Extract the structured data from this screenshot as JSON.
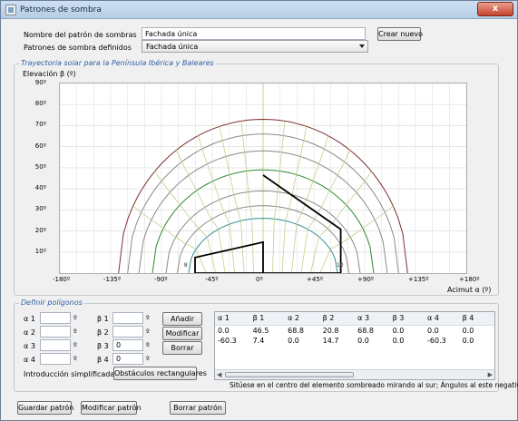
{
  "window": {
    "title": "Patrones de sombra",
    "close_label": "x"
  },
  "form": {
    "name_label": "Nombre del patrón de sombras",
    "name_value": "Fachada única",
    "create_button": "Crear nuevo",
    "defined_label": "Patrones de sombra definidos",
    "defined_value": "Fachada única"
  },
  "chart_group": {
    "title": "Trayectoria solar para la Península Ibérica y Baleares"
  },
  "chart_data": {
    "type": "line",
    "ylabel": "Elevación β (º)",
    "xlabel": "Acimut α (º)",
    "y_ticks": [
      "90º",
      "80º",
      "70º",
      "60º",
      "50º",
      "40º",
      "30º",
      "20º",
      "10º"
    ],
    "x_ticks": [
      "-180º",
      "-135º",
      "-90º",
      "-45º",
      "0º",
      "+45º",
      "+90º",
      "+135º",
      "+180º"
    ],
    "xlim": [
      -180,
      180
    ],
    "ylim": [
      0,
      90
    ],
    "sun_paths": [
      {
        "max_elevation": 73,
        "half_width": 128,
        "color": "#7f3030"
      },
      {
        "max_elevation": 66,
        "half_width": 120,
        "color": "#8a8a8a"
      },
      {
        "max_elevation": 58,
        "half_width": 110,
        "color": "#8a8a8a"
      },
      {
        "max_elevation": 49,
        "half_width": 98,
        "color": "#2f8a2f"
      },
      {
        "max_elevation": 39,
        "half_width": 86,
        "color": "#8a8a8a"
      },
      {
        "max_elevation": 32,
        "half_width": 76,
        "color": "#8a8a8a"
      },
      {
        "max_elevation": 26,
        "half_width": 66,
        "color": "#2f8f8f"
      }
    ],
    "obstacle_polygon": {
      "color": "#000000",
      "points": [
        [
          0,
          46.5
        ],
        [
          68.8,
          20.8
        ],
        [
          68.8,
          0
        ],
        [
          0,
          0
        ],
        [
          0,
          14.7
        ],
        [
          -60.3,
          7.4
        ],
        [
          -60.3,
          0
        ],
        [
          0,
          0
        ]
      ]
    },
    "hour_labels": [
      "8",
      "10"
    ]
  },
  "polygons": {
    "title": "Definir polígonos",
    "alpha_labels": [
      "α 1",
      "α 2",
      "α 3",
      "α 4"
    ],
    "beta_labels": [
      "β 1",
      "β 2",
      "β 3",
      "β 4"
    ],
    "alpha_values": [
      "",
      "",
      "",
      ""
    ],
    "beta_values": [
      "",
      "",
      "0",
      "0"
    ],
    "degree_symbol": "º",
    "add_button": "Añadir",
    "modify_button": "Modificar",
    "delete_button": "Borrar",
    "simplified_label": "Introducción simplificada",
    "rect_obstacles_button": "Obstáculos rectangulares",
    "table": {
      "columns": [
        "α 1",
        "β 1",
        "α 2",
        "β 2",
        "α 3",
        "β 3",
        "α 4",
        "β 4"
      ],
      "rows": [
        [
          "0.0",
          "46.5",
          "68.8",
          "20.8",
          "68.8",
          "0.0",
          "0.0",
          "0.0"
        ],
        [
          "-60.3",
          "7.4",
          "0.0",
          "14.7",
          "0.0",
          "0.0",
          "-60.3",
          "0.0"
        ]
      ]
    },
    "note": "Sitúese en el centro del elemento sombreado mirando al sur; Ángulos al este negativos"
  },
  "footer": {
    "save_button": "Guardar patrón",
    "modify_button": "Modificar patrón",
    "delete_button": "Borrar patrón"
  }
}
